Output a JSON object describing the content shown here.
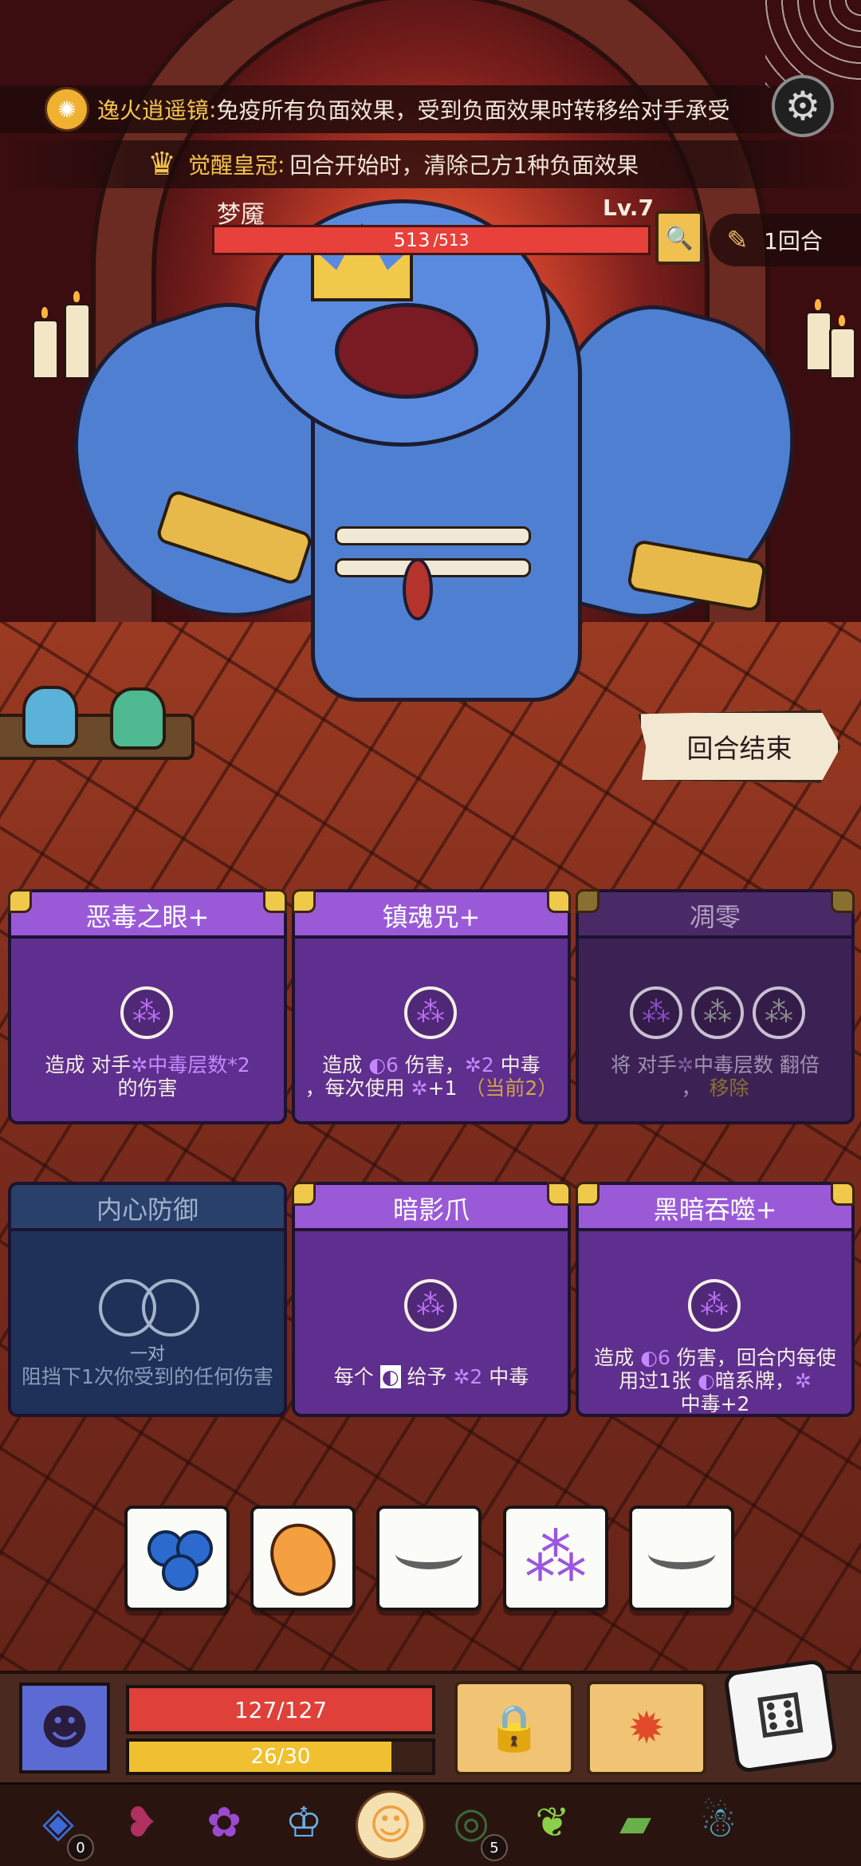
{
  "buffs": [
    {
      "name": "逸火逍遥镜",
      "sep": ":",
      "desc": "免疫所有负面效果，受到负面效果时转移给对手承受"
    },
    {
      "name": "觉醒皇冠",
      "sep": ":",
      "desc": "回合开始时，清除己方1种负面效果"
    }
  ],
  "boss": {
    "name": "梦魇",
    "level": "Lv.7",
    "hp": "513",
    "hp_max": "/513"
  },
  "round": {
    "label": "1回合"
  },
  "end_turn_label": "回合结束",
  "cards": {
    "c1": {
      "title": "恶毒之眼+",
      "t1": "造成 对手",
      "t1hl": "✲中毒层数*2",
      "t2": "的伤害"
    },
    "c2": {
      "title": "镇魂咒+",
      "t1a": "造成 ",
      "t1moon": "◐",
      "t1b": "6",
      "t1c": " 伤害，",
      "t1d": "✲2",
      "t1e": " 中毒",
      "t2a": "，每次使用 ",
      "t2b": "✲",
      "t2c": "+1",
      "t2d": "（当前2）"
    },
    "c3": {
      "title": "凋零",
      "t1a": "将 对手",
      "t1b": "✲",
      "t1c": "中毒层数 翻倍",
      "t2a": "，",
      "t2b": "移除"
    },
    "c4": {
      "title": "内心防御",
      "pair_label": "一对",
      "t1": "阻挡下1次你受到的任何伤害"
    },
    "c5": {
      "title": "暗影爪",
      "t1a": "每个 ",
      "t1b": "◐",
      "t1c": " 给予 ",
      "t1d": "✲2",
      "t1e": " 中毒"
    },
    "c6": {
      "title": "黑暗吞噬+",
      "t1a": "造成 ",
      "t1moon": "◐",
      "t1b": "6",
      "t1c": " 伤害，回合内每使用过1张 ",
      "t1d": "◐",
      "t1e": "暗系牌，",
      "t1f": "✲",
      "t2": "中毒+2"
    }
  },
  "dice": [
    "blue-berries",
    "orange",
    "closed-eye",
    "grapes",
    "closed-eye"
  ],
  "player": {
    "hp": "127/127",
    "hp_value": 127,
    "hp_max": 127,
    "energy": "26/30",
    "energy_value": 26,
    "energy_max": 30
  },
  "relics": [
    {
      "icon": "blue-gem-relic-icon",
      "count": "0"
    },
    {
      "icon": "broken-heart-relic-icon"
    },
    {
      "icon": "purple-apple-relic-icon"
    },
    {
      "icon": "ice-crown-relic-icon"
    },
    {
      "icon": "golden-mask-relic-icon"
    },
    {
      "icon": "dark-ring-relic-icon",
      "count": "5"
    },
    {
      "icon": "green-leaves-relic-icon"
    },
    {
      "icon": "green-scroll-relic-icon"
    },
    {
      "icon": "blue-ghost-relic-icon"
    }
  ],
  "colors": {
    "card_purple": "#9a5ad8",
    "card_body": "#5e2f8e",
    "hp_red": "#e0403a",
    "energy_yellow": "#f0c030",
    "poison": "#c688ff"
  }
}
